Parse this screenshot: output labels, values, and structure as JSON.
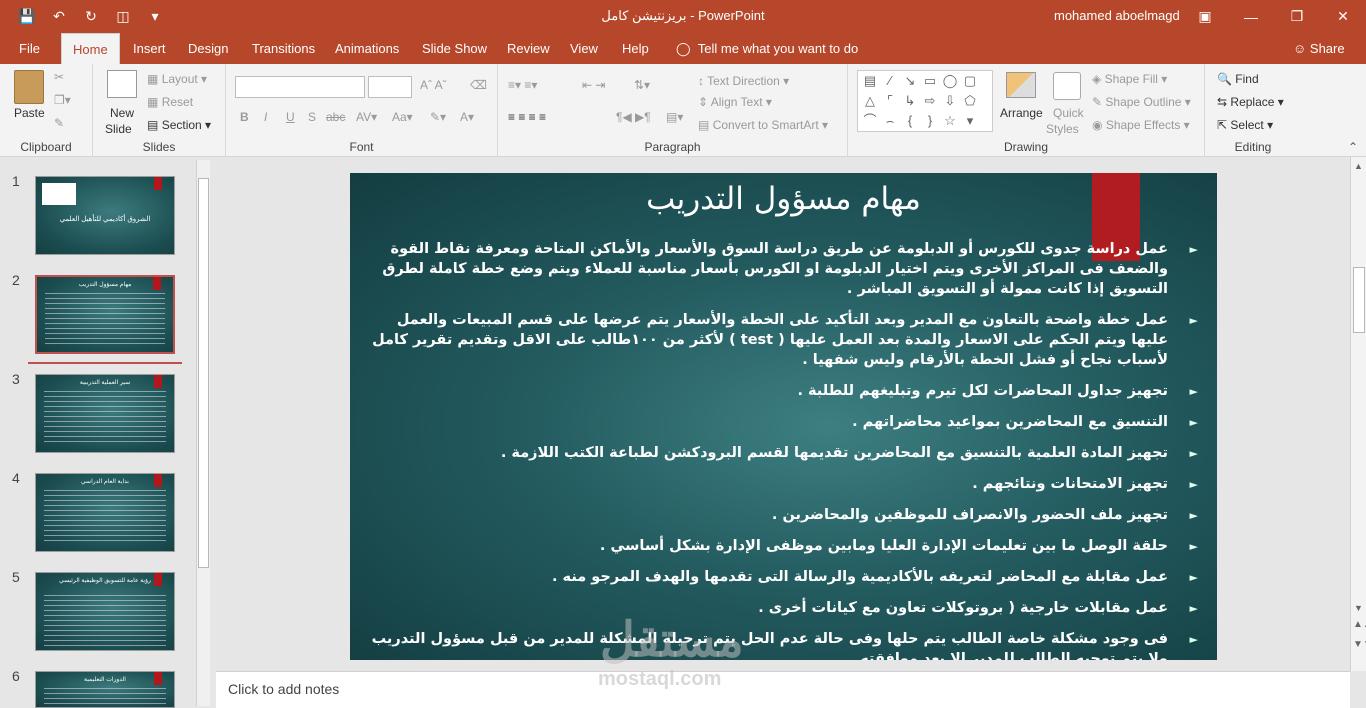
{
  "app": {
    "title": "بريزنتيشن كامل  -  PowerPoint",
    "user": "mohamed aboelmagd"
  },
  "tabs": [
    "File",
    "Home",
    "Insert",
    "Design",
    "Transitions",
    "Animations",
    "Slide Show",
    "Review",
    "View",
    "Help"
  ],
  "tellme": "Tell me what you want to do",
  "share": "Share",
  "ribbon": {
    "clipboard": {
      "paste": "Paste",
      "label": "Clipboard"
    },
    "slides": {
      "new_slide": "New",
      "new_slide2": "Slide",
      "layout": "Layout",
      "reset": "Reset",
      "section": "Section",
      "label": "Slides"
    },
    "font": {
      "label": "Font",
      "bold": "B",
      "italic": "I",
      "underline": "U",
      "shadow": "S",
      "strike": "abc"
    },
    "paragraph": {
      "text_direction": "Text Direction",
      "align_text": "Align Text",
      "smartart": "Convert to SmartArt",
      "label": "Paragraph"
    },
    "drawing": {
      "arrange": "Arrange",
      "quick1": "Quick",
      "quick2": "Styles",
      "fill": "Shape Fill",
      "outline": "Shape Outline",
      "effects": "Shape Effects",
      "label": "Drawing"
    },
    "editing": {
      "find": "Find",
      "replace": "Replace",
      "select": "Select",
      "label": "Editing"
    }
  },
  "thumbs": [
    {
      "n": "1",
      "title": "الشروق أكاديمي للتأهيل العلمي"
    },
    {
      "n": "2",
      "title": "مهام مسؤول التدريب"
    },
    {
      "n": "3",
      "title": "سير العملية التدريبية"
    },
    {
      "n": "4",
      "title": "بداية العام الدراسي"
    },
    {
      "n": "5",
      "title": "رؤية عامة للتسويق الوظيفية الرئيسي"
    },
    {
      "n": "6",
      "title": "الدورات التعليمية"
    }
  ],
  "slide": {
    "title": "مهام مسؤول التدريب",
    "bullets": [
      "عمل دراسة جدوى للكورس أو الدبلومة عن طريق دراسة السوق والأسعار والأماكن المتاحة ومعرفة نقاط القوة والضعف فى المراكز الأخرى ويتم اختيار الدبلومة او الكورس بأسعار مناسبة للعملاء ويتم وضع خطة كاملة لطرق التسويق إذا كانت ممولة أو التسويق المباشر .",
      "عمل خطة واضحة بالتعاون مع المدير وبعد التأكيد على الخطة والأسعار يتم عرضها على قسم المبيعات والعمل عليها ويتم الحكم على الاسعار والمدة بعد العمل عليها ( test ) لأكثر من ١٠٠طالب على الاقل وتقديم تقرير كامل لأسباب نجاح أو فشل الخطة بالأرقام وليس شفهيا .",
      "تجهيز جداول المحاضرات لكل تيرم وتبليغهم للطلبة .",
      "التنسيق مع المحاضرين بمواعيد محاضراتهم .",
      "تجهيز المادة العلمية بالتنسيق مع المحاضرين تقديمها لقسم البرودكشن لطباعة الكتب اللازمة .",
      "تجهيز الامتحانات ونتائجهم .",
      "تجهيز ملف الحضور والانصراف للموظفين والمحاضرين .",
      "حلقة الوصل ما بين تعليمات الإدارة العليا ومابين موظفى الإدارة بشكل أساسي .",
      "عمل مقابلة مع المحاضر لتعريفه بالأكاديمية والرسالة التى تقدمها والهدف المرجو منه .",
      "عمل مقابلات خارجية ( بروتوكلات تعاون مع كيانات أخرى .",
      "فى وجود مشكلة خاصة الطالب يتم حلها وفى حالة عدم الحل يتم ترحيله المشكلة للمدير من قبل مسؤول التدريب ولا يتم توجيه الطالب للمدير إلا بعد موافقته ."
    ]
  },
  "notes": "Click to add notes",
  "watermark": {
    "ar": "مستقل",
    "en": "mostaql.com"
  }
}
